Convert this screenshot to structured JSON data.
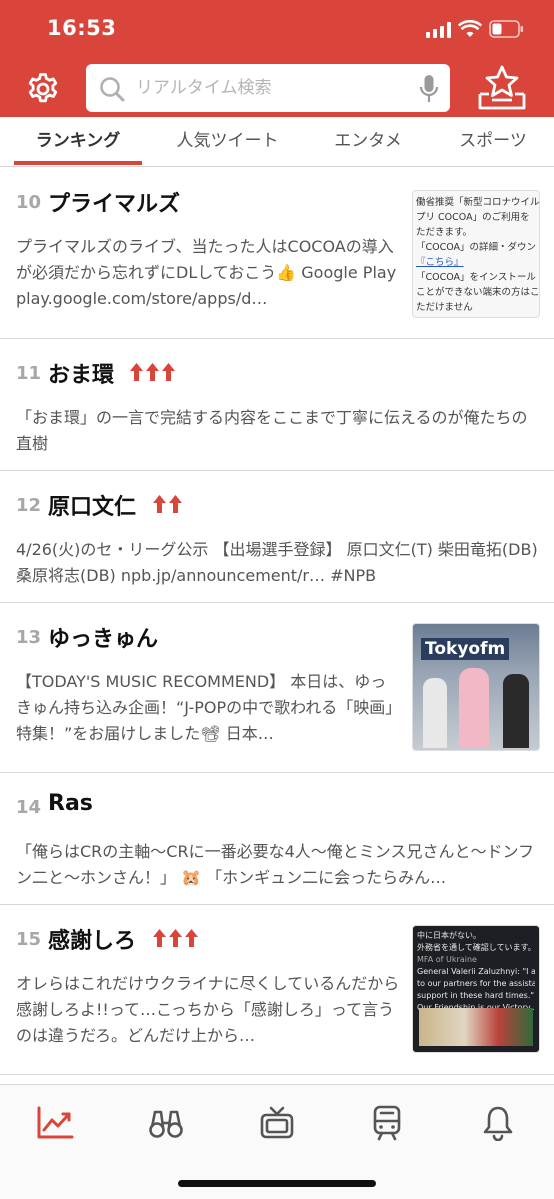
{
  "status": {
    "time": "16:53"
  },
  "search": {
    "placeholder": "リアルタイム検索"
  },
  "tabs": [
    {
      "label": "ランキング",
      "active": true
    },
    {
      "label": "人気ツイート",
      "active": false
    },
    {
      "label": "エンタメ",
      "active": false
    },
    {
      "label": "スポーツ",
      "active": false
    }
  ],
  "items": [
    {
      "rank": "10",
      "title": "プライマルズ",
      "arrows": 0,
      "desc": "プライマルズのライブ、当たった人はCOCOAの導入が必須だから忘れずにDLしておこう👍 Google Play play.google.com/store/apps/d…",
      "thumb_lines": [
        "働省推奨「新型コロナウイル",
        "プリ COCOA」のご利用を",
        "ただきます。",
        "「COCOA」の詳細・ダウン",
        "『こちら』",
        "「COCOA」をインストール",
        "ことができない端末の方はこ",
        "ただけません"
      ]
    },
    {
      "rank": "11",
      "title": "おま環",
      "arrows": 3,
      "desc": "「おま環」の一言で完結する内容をここまで丁寧に伝えるのが俺たちの直樹"
    },
    {
      "rank": "12",
      "title": "原口文仁",
      "arrows": 2,
      "desc": "4/26(火)のセ・リーグ公示 【出場選手登録】 原口文仁(T) 柴田竜拓(DB) 桑原将志(DB) npb.jp/announcement/r… #NPB"
    },
    {
      "rank": "13",
      "title": "ゆっきゅん",
      "arrows": 0,
      "desc": "【TODAY'S MUSIC RECOMMEND】 本日は、ゆっきゅん持ち込み企画！“J-POPの中で歌われる「映画」特集！”をお届けしました📽 日本…",
      "thumb_text": "Tokyofm"
    },
    {
      "rank": "14",
      "title": "Ras",
      "arrows": 0,
      "desc": "「俺らはCRの主軸〜CRに一番必要な4人〜俺とミンス兄さんと〜ドンフン二と〜ホンさん！」 🐹 「ホンギュン二に会ったらみん…"
    },
    {
      "rank": "15",
      "title": "感謝しろ",
      "arrows": 3,
      "desc": "オレらはこれだけウクライナに尽くしているんだから感謝しろよ!!って…こっちから「感謝しろ」って言うのは違うだろ。どんだけ上から…",
      "thumb_lines": [
        "中に日本がない。",
        "外務省を通して確認しています。",
        "MFA of Ukraine",
        "General Valerii Zaluzhnyi: \"I am sincerely grateful",
        "to our partners for the assistance and unwavering",
        "support in these hard times.\"",
        "Our Friendship is our Victory..."
      ]
    }
  ],
  "nav": [
    "trending-icon",
    "binoculars-icon",
    "tv-icon",
    "train-icon",
    "bell-icon"
  ],
  "colors": {
    "brand": "#d9453b",
    "arrow": "#d9453b"
  }
}
